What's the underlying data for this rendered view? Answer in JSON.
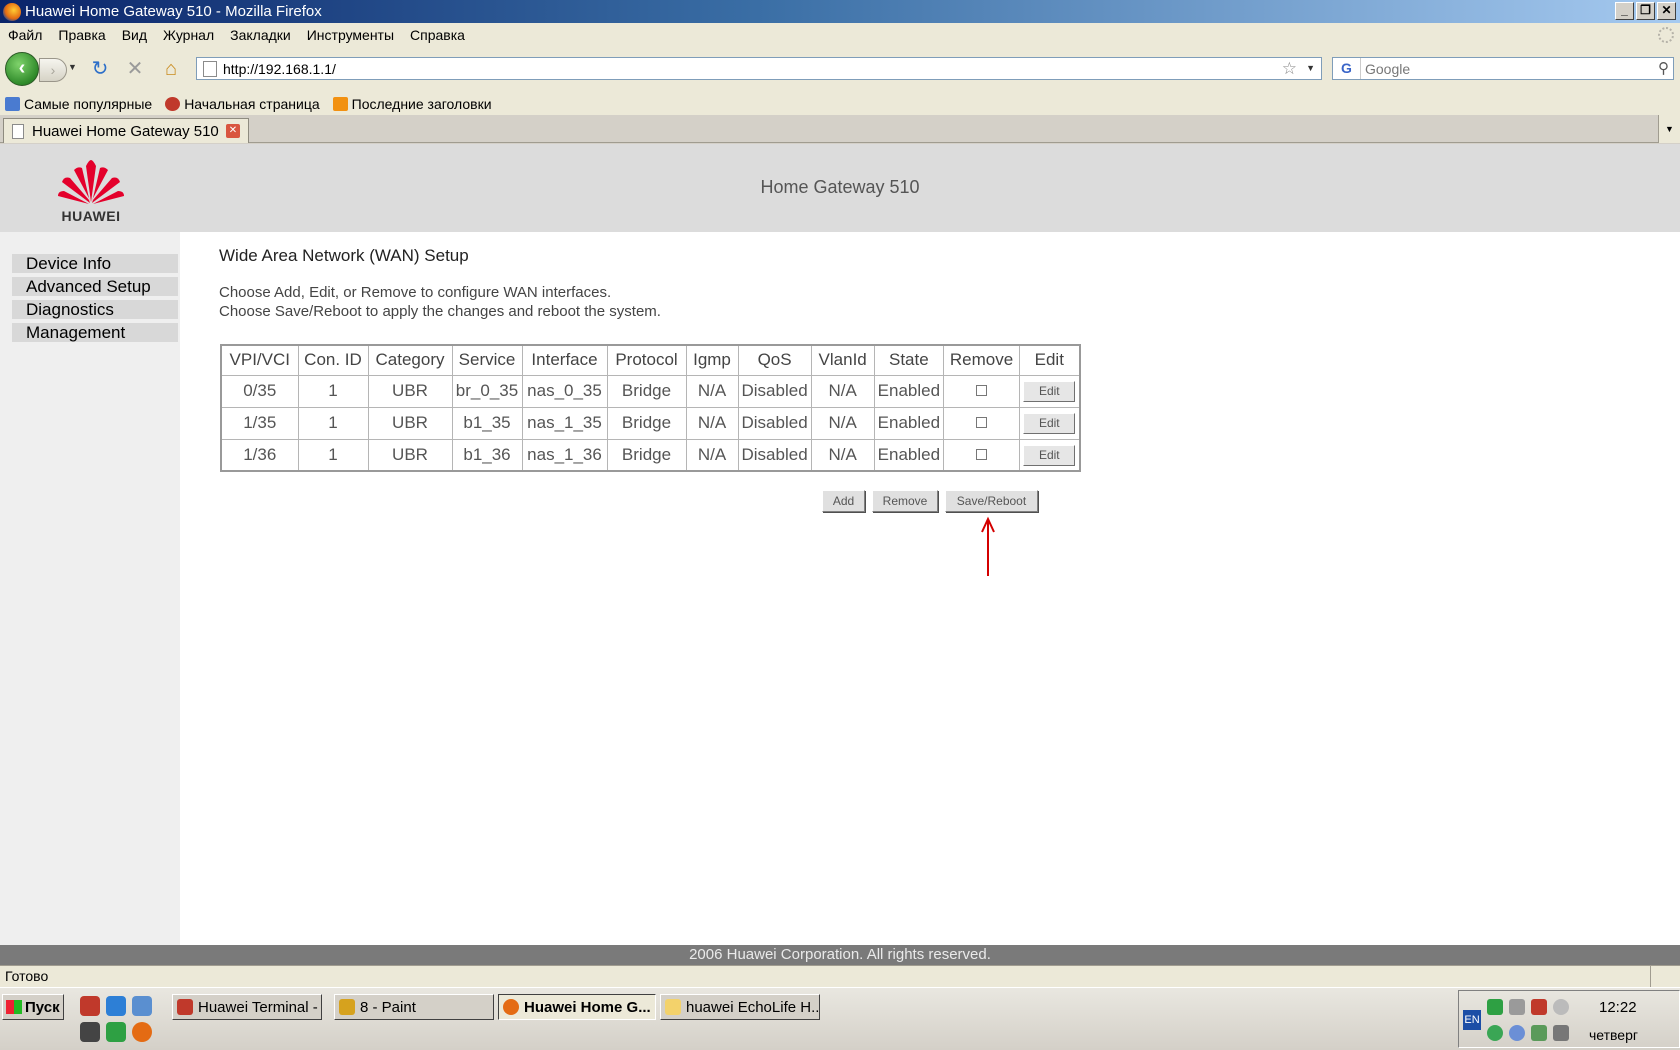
{
  "window": {
    "title": "Huawei Home Gateway 510 - Mozilla Firefox"
  },
  "menu": [
    "Файл",
    "Правка",
    "Вид",
    "Журнал",
    "Закладки",
    "Инструменты",
    "Справка"
  ],
  "navigation": {
    "url": "http://192.168.1.1/",
    "search_placeholder": "Google",
    "search_engine_icon": "google-icon"
  },
  "bookmarks": [
    {
      "label": "Самые популярные",
      "icon": "most-visited-icon"
    },
    {
      "label": "Начальная страница",
      "icon": "start-page-icon"
    },
    {
      "label": "Последние заголовки",
      "icon": "rss-feed-icon"
    }
  ],
  "tab": {
    "label": "Huawei Home Gateway 510"
  },
  "router": {
    "brand": "HUAWEI",
    "product_title": "Home Gateway 510",
    "sidebar": [
      "Device Info",
      "Advanced Setup",
      "Diagnostics",
      "Management"
    ],
    "page_title": "Wide Area Network (WAN) Setup",
    "instructions": [
      "Choose Add, Edit, or Remove to configure WAN interfaces.",
      "Choose Save/Reboot to apply the changes and reboot the system."
    ],
    "table": {
      "columns": [
        "VPI/VCI",
        "Con. ID",
        "Category",
        "Service",
        "Interface",
        "Protocol",
        "Igmp",
        "QoS",
        "VlanId",
        "State",
        "Remove",
        "Edit"
      ],
      "rows": [
        {
          "vpi_vci": "0/35",
          "con_id": "1",
          "category": "UBR",
          "service": "br_0_35",
          "interface": "nas_0_35",
          "protocol": "Bridge",
          "igmp": "N/A",
          "qos": "Disabled",
          "vlan_id": "N/A",
          "state": "Enabled",
          "remove_checked": false,
          "edit_label": "Edit"
        },
        {
          "vpi_vci": "1/35",
          "con_id": "1",
          "category": "UBR",
          "service": "b1_35",
          "interface": "nas_1_35",
          "protocol": "Bridge",
          "igmp": "N/A",
          "qos": "Disabled",
          "vlan_id": "N/A",
          "state": "Enabled",
          "remove_checked": false,
          "edit_label": "Edit"
        },
        {
          "vpi_vci": "1/36",
          "con_id": "1",
          "category": "UBR",
          "service": "b1_36",
          "interface": "nas_1_36",
          "protocol": "Bridge",
          "igmp": "N/A",
          "qos": "Disabled",
          "vlan_id": "N/A",
          "state": "Enabled",
          "remove_checked": false,
          "edit_label": "Edit"
        }
      ]
    },
    "buttons": {
      "add": "Add",
      "remove": "Remove",
      "save_reboot": "Save/Reboot"
    },
    "annotation_arrow_color": "#d40000",
    "copyright": "2006 Huawei Corporation. All rights reserved."
  },
  "status": "Готово",
  "taskbar": {
    "start_label": "Пуск",
    "tasks": [
      {
        "label": "Huawei Terminal - ...",
        "icon": "opera-icon",
        "active": false
      },
      {
        "label": "8 - Paint",
        "icon": "paint-icon",
        "active": false
      },
      {
        "label": "Huawei Home G...",
        "icon": "firefox-icon",
        "active": true
      },
      {
        "label": "huawei EchoLife H...",
        "icon": "folder-icon",
        "active": false
      }
    ],
    "language": "EN",
    "time": "12:22",
    "day": "четверг"
  },
  "colors": {
    "title_bar": "#0a246a",
    "header_gray": "#dcdcdc",
    "sidebar_item": "#d8d8d8",
    "footer_gray": "#7a7a7a",
    "huawei_red": "#e4002b"
  }
}
